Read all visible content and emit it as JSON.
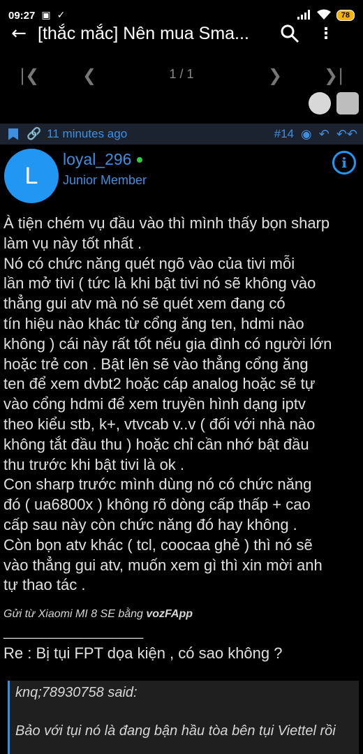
{
  "status_bar": {
    "time": "09:27",
    "battery": "78"
  },
  "app_bar": {
    "title": "[thắc mắc] Nên mua Sma..."
  },
  "pager": {
    "page_info": "1 / 1"
  },
  "post": {
    "time_ago": "11 minutes ago",
    "post_number": "#14",
    "author": {
      "avatar_letter": "L",
      "username": "loyal_296",
      "role": "Junior Member"
    },
    "body_lines": [
      "À tiện chém vụ đầu vào thì mình thấy bọn sharp",
      "làm vụ này tốt nhất .",
      "Nó có chức năng quét ngõ vào của tivi mỗi",
      "lần mở tivi ( tức là khi bật tivi nó sẽ không vào",
      "thẳng gui atv mà nó sẽ quét xem đang có",
      "tín hiệu nào khác từ cổng ăng ten, hdmi nào",
      "không ) cái này rất tốt nếu gia đình có người lớn",
      "hoặc trẻ con . Bật lên sẽ vào thẳng cổng ăng",
      "ten để xem dvbt2 hoặc cáp analog hoặc sẽ tự",
      "vào cổng hdmi để xem truyền hình dạng iptv",
      "theo kiểu stb, k+, vtvcab v..v ( đối với nhà nào",
      "không tắt đầu thu ) hoặc chỉ cần nhớ bật đầu",
      "thu trước khi bật tivi là ok .",
      "Con sharp trước mình dùng nó có chức năng",
      "đó ( ua6800x ) không rõ dòng cấp thấp + cao",
      "cấp sau này còn chức năng đó hay không .",
      "Còn bọn atv khác ( tcl, coocaa ghẻ ) thì nó sẽ",
      "vào thẳng gui atv, muốn xem gì thì xin mời anh",
      "tự thao tác ."
    ],
    "signature_prefix": "Gửi từ Xiaomi MI 8 SE bằng ",
    "signature_app": "vozFApp",
    "separator": "__________________",
    "reply_title": "Re : Bị tụi FPT dọa kiện , có sao không ?",
    "quote": {
      "author_said": "knq;78930758 said:",
      "text": "Bảo với tụi nó là đang bận hầu tòa bên tụi Viettel rồi"
    }
  },
  "colors": {
    "accent": "#3f8fe0",
    "avatar_bg": "#2196f3",
    "post_bar_bg": "#1c2330",
    "online": "#2ecc40",
    "battery": "#f6b400"
  }
}
